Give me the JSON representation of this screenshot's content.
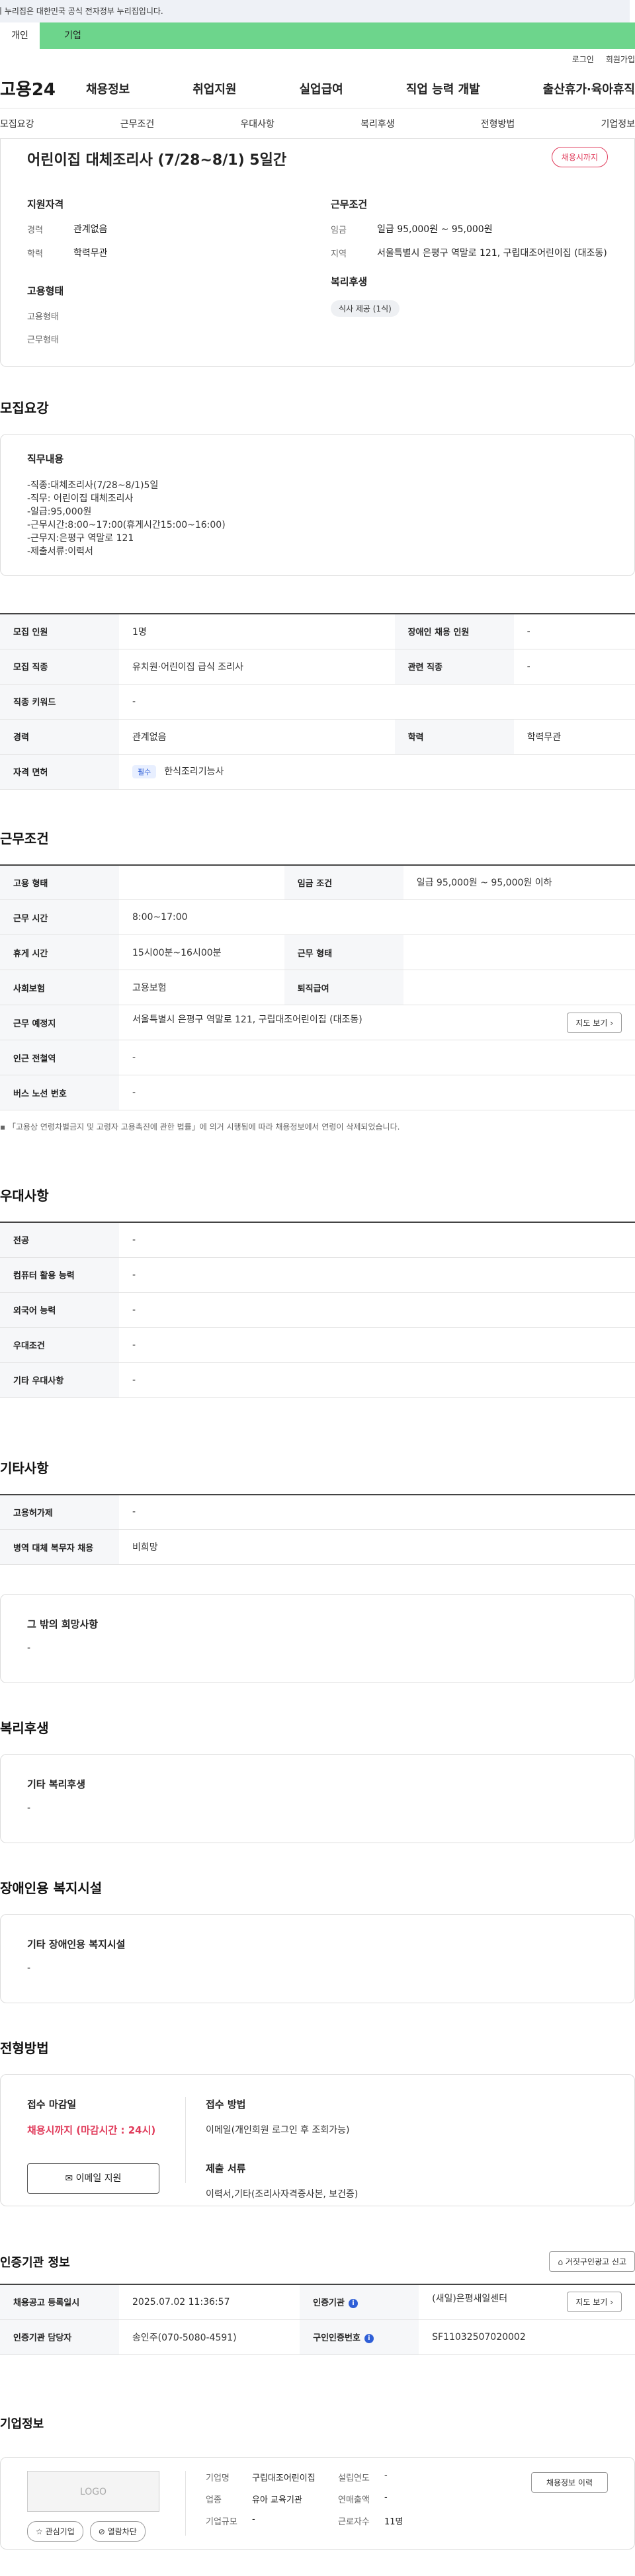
{
  "gov_banner": "이 누리집은 대한민국 공식 전자정부 누리집입니다.",
  "top_tabs": [
    {
      "label": "개인"
    },
    {
      "label": "기업"
    }
  ],
  "util": {
    "login": "로그인",
    "join": "회원가입"
  },
  "gnb": {
    "logo": "고용24",
    "menu": [
      "채용정보",
      "취업지원",
      "실업급여",
      "직업 능력 개발",
      "출산휴가·육아휴직"
    ]
  },
  "subnav": [
    "모집요강",
    "근무조건",
    "우대사항",
    "복리후생",
    "전형방법",
    "기업정보"
  ],
  "summary": {
    "title": "어린이집 대체조리사 (7/28~8/1) 5일간",
    "status_badge": "채용시까지",
    "qual_heading": "지원자격",
    "qual": [
      {
        "k": "경력",
        "v": "관계없음"
      },
      {
        "k": "학력",
        "v": "학력무관"
      }
    ],
    "cond_heading": "근무조건",
    "cond": [
      {
        "k": "임금",
        "v": "일급 95,000원 ~ 95,000원"
      },
      {
        "k": "지역",
        "v": "서울특별시 은평구 역말로 121, 구립대조어린이집 (대조동)"
      }
    ],
    "emp_heading": "고용형태",
    "emp": [
      {
        "k": "고용형태",
        "v": ""
      },
      {
        "k": "근무형태",
        "v": ""
      }
    ],
    "welfare_heading": "복리후생",
    "welfare_pill": "식사 제공 (1식)"
  },
  "recruit": {
    "title": "모집요강",
    "duty_heading": "직무내용",
    "duty_lines": [
      "-직종:대체조리사(7/28~8/1)5일",
      "-직무: 어린이집 대체조리사",
      "-일급:95,000원",
      "-근무시간:8:00~17:00(휴게시간15:00~16:00)",
      "-근무지:은평구 역말로 121",
      "-제출서류:이력서"
    ],
    "table": [
      [
        {
          "k": "모집 인원",
          "v": "1명"
        },
        {
          "k": "장애인 채용 인원",
          "v": "-"
        }
      ],
      [
        {
          "k": "모집 직종",
          "v": "유치원·어린이집 급식 조리사"
        },
        {
          "k": "관련 직종",
          "v": "-"
        }
      ],
      [
        {
          "k": "직종 키워드",
          "v": "-"
        }
      ],
      [
        {
          "k": "경력",
          "v": "관계없음"
        },
        {
          "k": "학력",
          "v": "학력무관"
        }
      ],
      [
        {
          "k": "자격 면허",
          "v": "한식조리기능사",
          "tag": "필수"
        }
      ]
    ]
  },
  "work": {
    "title": "근무조건",
    "table": [
      [
        {
          "k": "고용 형태",
          "v": ""
        },
        {
          "k": "임금 조건",
          "v": "일급 95,000원 ~ 95,000원 이하"
        }
      ],
      [
        {
          "k": "근무 시간",
          "v": "8:00~17:00"
        }
      ],
      [
        {
          "k": "휴게 시간",
          "v": "15시00분~16시00분"
        },
        {
          "k": "근무 형태",
          "v": ""
        }
      ],
      [
        {
          "k": "사회보험",
          "v": "고용보험"
        },
        {
          "k": "퇴직급여",
          "v": ""
        }
      ],
      [
        {
          "k": "근무 예정지",
          "v": "서울특별시 은평구 역말로 121, 구립대조어린이집 (대조동)",
          "btn": "지도 보기"
        }
      ],
      [
        {
          "k": "인근 전철역",
          "v": "-"
        }
      ],
      [
        {
          "k": "버스 노선 번호",
          "v": "-"
        }
      ]
    ],
    "note": "「고용상 연령차별금지 및 고령자 고용촉진에 관한 법률」에 의거 시행됨에 따라 채용정보에서 연령이 삭제되었습니다."
  },
  "pref": {
    "title": "우대사항",
    "table": [
      [
        {
          "k": "전공",
          "v": "-"
        }
      ],
      [
        {
          "k": "컴퓨터 활용 능력",
          "v": "-"
        }
      ],
      [
        {
          "k": "외국어 능력",
          "v": "-"
        }
      ],
      [
        {
          "k": "우대조건",
          "v": "-"
        }
      ],
      [
        {
          "k": "기타 우대사항",
          "v": "-"
        }
      ]
    ]
  },
  "etc": {
    "title": "기타사항",
    "table": [
      [
        {
          "k": "고용허가제",
          "v": "-"
        }
      ],
      [
        {
          "k": "병역 대체 복무자 채용",
          "v": "비희망"
        }
      ]
    ],
    "card_heading": "그 밖의 희망사항",
    "card_value": "-"
  },
  "welfare": {
    "title": "복리후생",
    "card_heading": "기타 복리후생",
    "card_value": "-"
  },
  "disabled": {
    "title": "장애인용 복지시설",
    "card_heading": "기타 장애인용 복지시설",
    "card_value": "-"
  },
  "apply": {
    "title": "전형방법",
    "deadline_heading": "접수 마감일",
    "deadline": "채용시까지 (마감시간 : 24시)",
    "email_btn": "이메일 지원",
    "method_heading": "접수 방법",
    "method": "이메일(개인회원 로그인 후 조회가능)",
    "docs_heading": "제출 서류",
    "docs": "이력서,기타(조리사자격증사본, 보건증)"
  },
  "agency": {
    "title": "인증기관 정보",
    "report_btn": "거짓구인광고 신고",
    "table": [
      [
        {
          "k": "채용공고 등록일시",
          "v": "2025.07.02 11:36:57"
        },
        {
          "k": "인증기관",
          "v": "(새일)은평새일센터",
          "btn": "지도 보기",
          "info": true
        }
      ],
      [
        {
          "k": "인증기관 담당자",
          "v": "송인주(070-5080-4591)"
        },
        {
          "k": "구인인증번호",
          "v": "SF11032507020002",
          "info": true
        }
      ]
    ]
  },
  "company": {
    "title": "기업정보",
    "logo_text": "LOGO",
    "fav_btn": "관심기업",
    "block_btn": "열람차단",
    "history_btn": "채용정보 이력",
    "fields": [
      [
        {
          "k": "기업명",
          "v": "구립대조어린이집"
        },
        {
          "k": "설립연도",
          "v": "-"
        }
      ],
      [
        {
          "k": "업종",
          "v": "유아 교육기관"
        },
        {
          "k": "연매출액",
          "v": "-"
        }
      ],
      [
        {
          "k": "기업규모",
          "v": "-"
        },
        {
          "k": "근로자수",
          "v": "11명"
        }
      ]
    ]
  }
}
